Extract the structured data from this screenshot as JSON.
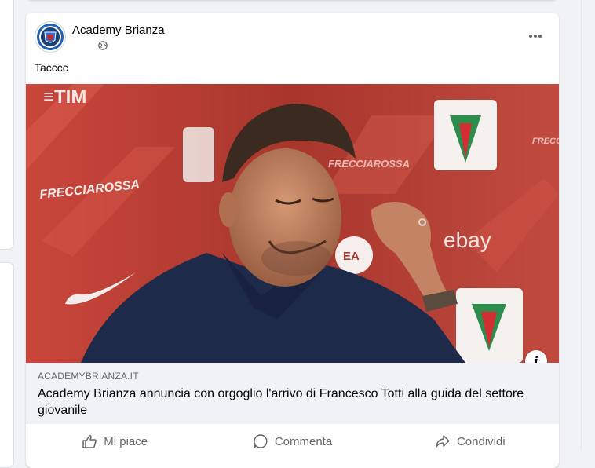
{
  "post": {
    "page_name": "Academy Brianza",
    "privacy_icon": "globe-icon",
    "text": "Tacccc",
    "menu_icon": "more-options-icon"
  },
  "link_preview": {
    "domain": "ACADEMYBRIANZA.IT",
    "title": "Academy Brianza annuncia con orgoglio l'arrivo di Francesco Totti alla guida del settore giovanile",
    "info_icon": "info-icon",
    "info_symbol": "i"
  },
  "actions": {
    "like": "Mi piace",
    "comment": "Commenta",
    "share": "Condividi"
  },
  "colors": {
    "background": "#f0f2f5",
    "secondary_text": "#65676b",
    "backdrop_red": "#b43a2e"
  }
}
